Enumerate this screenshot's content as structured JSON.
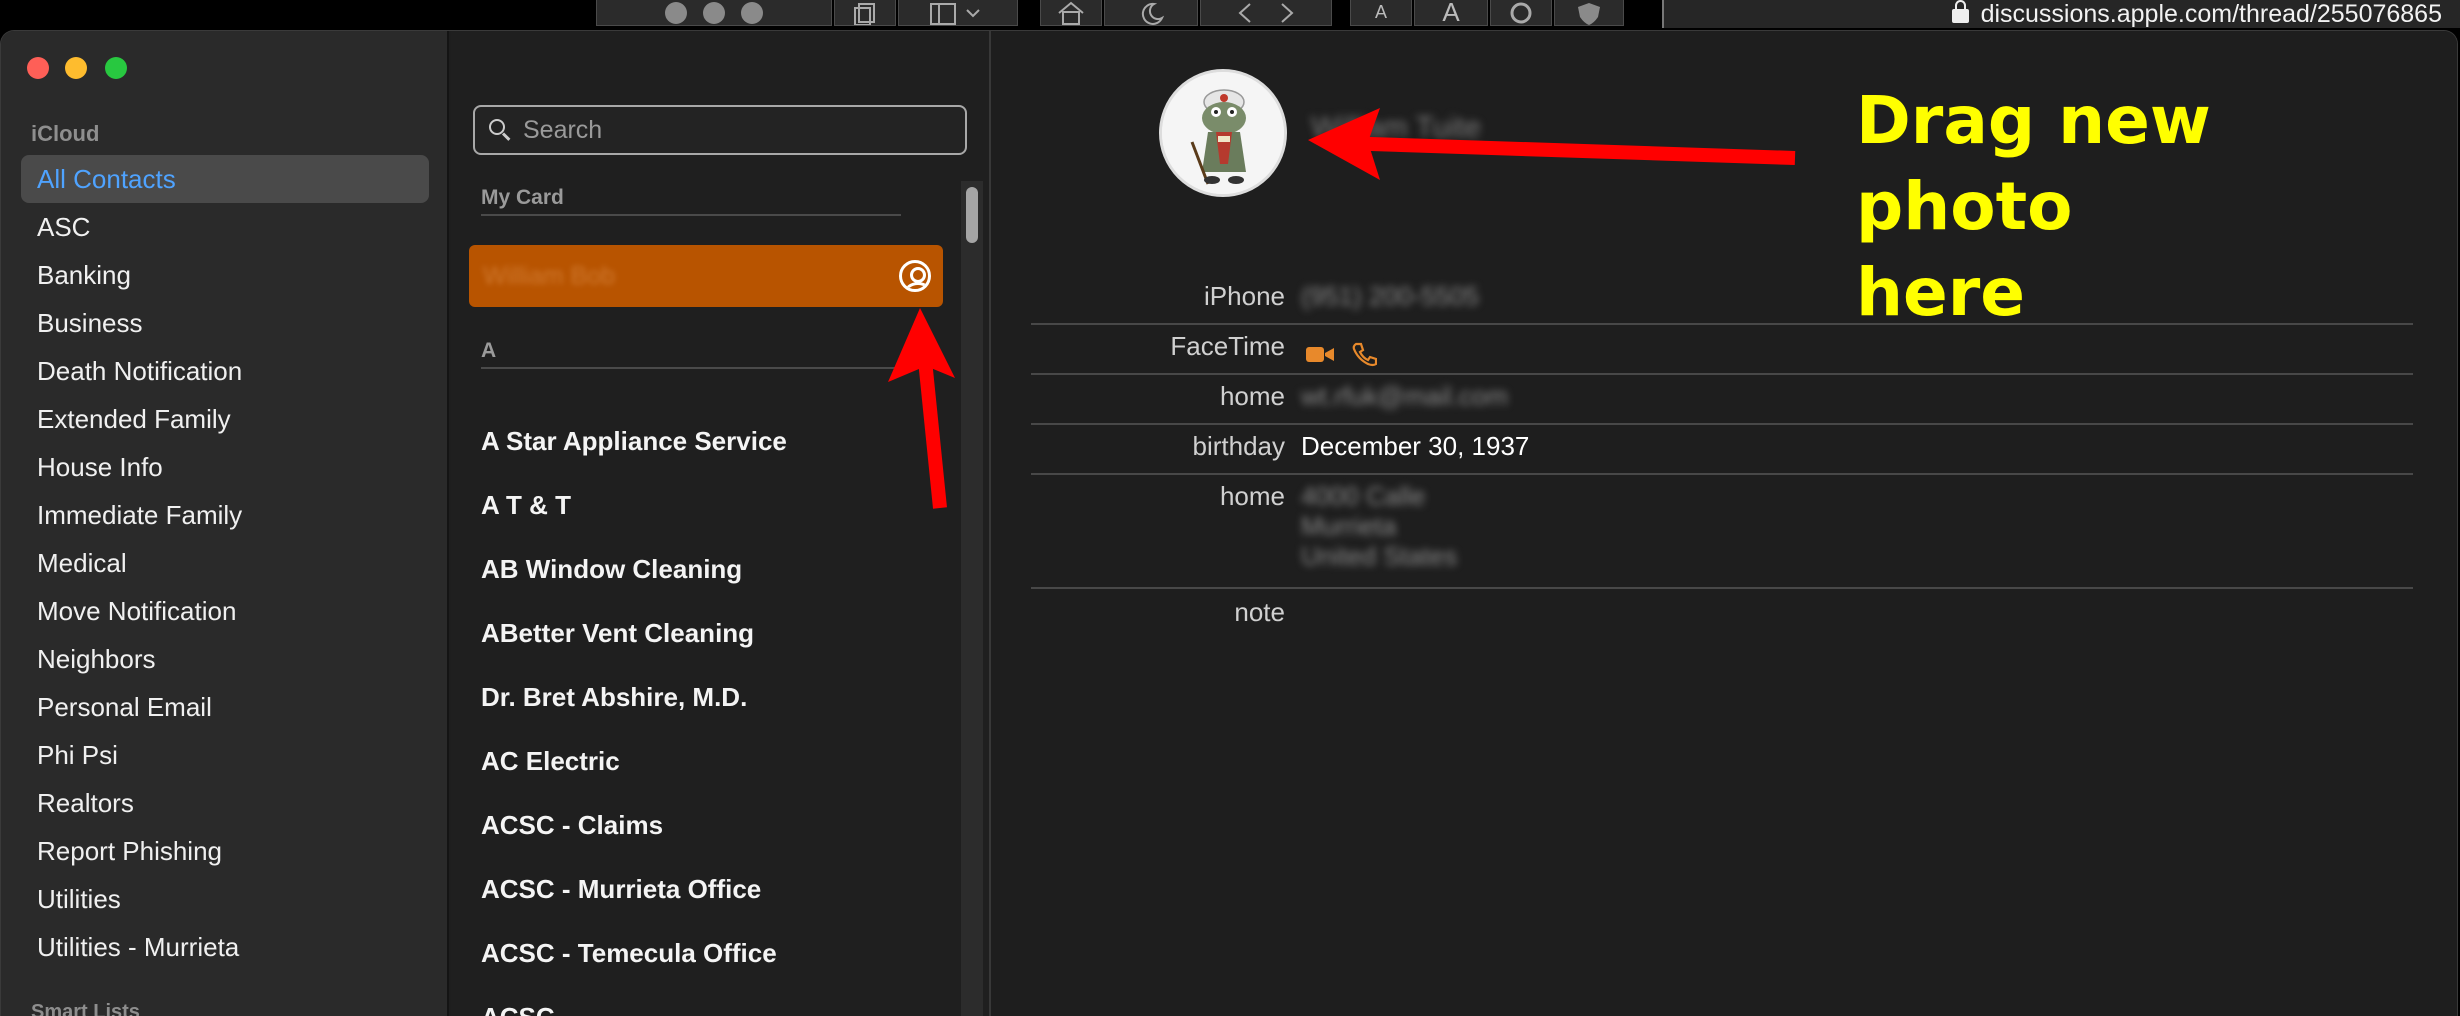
{
  "browser": {
    "url": "discussions.apple.com/thread/255076865",
    "font_small": "A",
    "font_large": "A"
  },
  "sidebar": {
    "section_icloud": "iCloud",
    "items": [
      {
        "label": "All Contacts",
        "selected": true
      },
      {
        "label": "ASC"
      },
      {
        "label": "Banking"
      },
      {
        "label": "Business"
      },
      {
        "label": "Death Notification"
      },
      {
        "label": "Extended Family"
      },
      {
        "label": "House Info"
      },
      {
        "label": "Immediate Family"
      },
      {
        "label": "Medical"
      },
      {
        "label": "Move Notification"
      },
      {
        "label": "Neighbors"
      },
      {
        "label": "Personal Email"
      },
      {
        "label": "Phi Psi"
      },
      {
        "label": "Realtors"
      },
      {
        "label": "Report Phishing"
      },
      {
        "label": "Utilities"
      },
      {
        "label": "Utilities - Murrieta"
      }
    ],
    "section_smart": "Smart Lists"
  },
  "list": {
    "search_placeholder": "Search",
    "my_card_header": "My Card",
    "my_card_name": "William Bob",
    "section_a": "A",
    "contacts": [
      "A Star Appliance Service",
      "A T & T",
      "AB Window Cleaning",
      "ABetter Vent Cleaning",
      "Dr. Bret Abshire, M.D.",
      "AC Electric",
      "ACSC - Claims",
      "ACSC - Murrieta Office",
      "ACSC - Temecula Office",
      "ACSC"
    ]
  },
  "detail": {
    "name": "William Tuite",
    "fields": {
      "iphone_label": "iPhone",
      "iphone_value": "(951) 200-5505",
      "facetime_label": "FaceTime",
      "home_email_label": "home",
      "home_email_value": "wt.rfuk@mail.com",
      "birthday_label": "birthday",
      "birthday_value": "December 30, 1937",
      "home_address_label": "home",
      "home_address_line1": "4000 Calle",
      "home_address_line2": "Murrieta",
      "home_address_line3": "United States",
      "note_label": "note"
    }
  },
  "annotation": {
    "text_line1": "Drag new photo",
    "text_line2": "here",
    "arrow_color": "#ff0000",
    "text_color": "#ffff00"
  },
  "colors": {
    "selection_blue": "#4fa3ff",
    "my_card_orange": "#b85400",
    "facetime_orange": "#e8892b"
  }
}
